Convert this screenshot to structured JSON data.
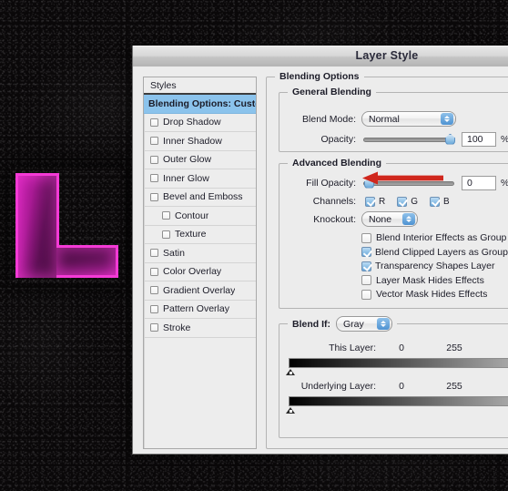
{
  "dialog": {
    "title": "Layer Style"
  },
  "styles_panel": {
    "header": "Styles",
    "items": [
      {
        "label": "Blending Options: Custom",
        "selected": true,
        "checkbox": false,
        "indent": false
      },
      {
        "label": "Drop Shadow",
        "selected": false,
        "checkbox": true,
        "checked": false,
        "indent": false
      },
      {
        "label": "Inner Shadow",
        "selected": false,
        "checkbox": true,
        "checked": false,
        "indent": false
      },
      {
        "label": "Outer Glow",
        "selected": false,
        "checkbox": true,
        "checked": false,
        "indent": false
      },
      {
        "label": "Inner Glow",
        "selected": false,
        "checkbox": true,
        "checked": false,
        "indent": false
      },
      {
        "label": "Bevel and Emboss",
        "selected": false,
        "checkbox": true,
        "checked": false,
        "indent": false
      },
      {
        "label": "Contour",
        "selected": false,
        "checkbox": true,
        "checked": false,
        "indent": true
      },
      {
        "label": "Texture",
        "selected": false,
        "checkbox": true,
        "checked": false,
        "indent": true
      },
      {
        "label": "Satin",
        "selected": false,
        "checkbox": true,
        "checked": false,
        "indent": false
      },
      {
        "label": "Color Overlay",
        "selected": false,
        "checkbox": true,
        "checked": false,
        "indent": false
      },
      {
        "label": "Gradient Overlay",
        "selected": false,
        "checkbox": true,
        "checked": false,
        "indent": false
      },
      {
        "label": "Pattern Overlay",
        "selected": false,
        "checkbox": true,
        "checked": false,
        "indent": false
      },
      {
        "label": "Stroke",
        "selected": false,
        "checkbox": true,
        "checked": false,
        "indent": false
      }
    ]
  },
  "blending_options": {
    "legend": "Blending Options",
    "general": {
      "legend": "General Blending",
      "blend_mode_label": "Blend Mode:",
      "blend_mode_value": "Normal",
      "opacity_label": "Opacity:",
      "opacity_value": "100",
      "opacity_percent_sign": "%",
      "opacity_slider_position_pct": 100
    },
    "advanced": {
      "legend": "Advanced Blending",
      "fill_opacity_label": "Fill Opacity:",
      "fill_opacity_value": "0",
      "fill_opacity_percent_sign": "%",
      "fill_opacity_slider_position_pct": 0,
      "channels_label": "Channels:",
      "channels": [
        {
          "label": "R",
          "checked": true
        },
        {
          "label": "G",
          "checked": true
        },
        {
          "label": "B",
          "checked": true
        }
      ],
      "knockout_label": "Knockout:",
      "knockout_value": "None",
      "options": [
        {
          "label": "Blend Interior Effects as Group",
          "checked": false
        },
        {
          "label": "Blend Clipped Layers as Group",
          "checked": true
        },
        {
          "label": "Transparency Shapes Layer",
          "checked": true
        },
        {
          "label": "Layer Mask Hides Effects",
          "checked": false
        },
        {
          "label": "Vector Mask Hides Effects",
          "checked": false
        }
      ]
    },
    "blend_if": {
      "legend": "Blend If:",
      "channel_value": "Gray",
      "this_layer": {
        "label": "This Layer:",
        "low": "0",
        "high": "255"
      },
      "underlying_layer": {
        "label": "Underlying Layer:",
        "low": "0",
        "high": "255"
      }
    }
  },
  "annotation": {
    "arrow_color": "#d0271d",
    "arrow_points_to": "fill-opacity-slider"
  },
  "artwork": {
    "letter": "L",
    "stroke_color": "#f43ad6",
    "fill_color_light": "#c81fb0",
    "fill_color_dark": "#3a0a34",
    "background_color": "#0b090a"
  }
}
